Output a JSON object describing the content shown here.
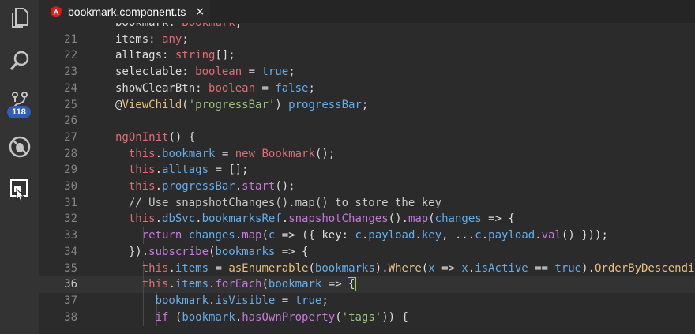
{
  "activity_bar": {
    "items": [
      {
        "name": "explorer-icon"
      },
      {
        "name": "search-icon"
      },
      {
        "name": "source-control-icon",
        "badge": "118"
      },
      {
        "name": "debug-icon"
      },
      {
        "name": "extensions-icon"
      }
    ]
  },
  "tab": {
    "title": "bookmark.component.ts",
    "close": "×",
    "icon": "angular-icon"
  },
  "editor": {
    "current_line": "36",
    "lines": [
      {
        "n": "",
        "indent": 1,
        "tokens": [
          [
            "p",
            "bookmark: "
          ],
          [
            "ty",
            "Bookmark"
          ],
          [
            "p",
            ";"
          ]
        ]
      },
      {
        "n": "21",
        "indent": 1,
        "tokens": [
          [
            "p",
            "items: "
          ],
          [
            "ty",
            "any"
          ],
          [
            "p",
            ";"
          ]
        ]
      },
      {
        "n": "22",
        "indent": 1,
        "tokens": [
          [
            "p",
            "alltags: "
          ],
          [
            "ty",
            "string"
          ],
          [
            "p",
            "[];"
          ]
        ]
      },
      {
        "n": "23",
        "indent": 1,
        "tokens": [
          [
            "p",
            "selectable: "
          ],
          [
            "ty",
            "boolean"
          ],
          [
            "p",
            " = "
          ],
          [
            "num",
            "true"
          ],
          [
            "p",
            ";"
          ]
        ]
      },
      {
        "n": "24",
        "indent": 1,
        "tokens": [
          [
            "p",
            "showClearBtn: "
          ],
          [
            "ty",
            "boolean"
          ],
          [
            "p",
            " = "
          ],
          [
            "num",
            "false"
          ],
          [
            "p",
            ";"
          ]
        ]
      },
      {
        "n": "25",
        "indent": 1,
        "tokens": [
          [
            "p",
            "@"
          ],
          [
            "dec",
            "ViewChild"
          ],
          [
            "p",
            "("
          ],
          [
            "s",
            "'progressBar'"
          ],
          [
            "p",
            ") "
          ],
          [
            "pr",
            "progressBar"
          ],
          [
            "p",
            ";"
          ]
        ]
      },
      {
        "n": "26",
        "indent": 1,
        "tokens": []
      },
      {
        "n": "27",
        "indent": 1,
        "tokens": [
          [
            "ty",
            "ngOnInit"
          ],
          [
            "p",
            "() {"
          ]
        ]
      },
      {
        "n": "28",
        "indent": 2,
        "tokens": [
          [
            "this",
            "this"
          ],
          [
            "p",
            "."
          ],
          [
            "pr",
            "bookmark"
          ],
          [
            "p",
            " = "
          ],
          [
            "k",
            "new "
          ],
          [
            "ty",
            "Bookmark"
          ],
          [
            "p",
            "();"
          ]
        ]
      },
      {
        "n": "29",
        "indent": 2,
        "tokens": [
          [
            "this",
            "this"
          ],
          [
            "p",
            "."
          ],
          [
            "pr",
            "alltags"
          ],
          [
            "p",
            " = [];"
          ]
        ]
      },
      {
        "n": "30",
        "indent": 2,
        "tokens": [
          [
            "this",
            "this"
          ],
          [
            "p",
            "."
          ],
          [
            "pr",
            "progressBar"
          ],
          [
            "p",
            "."
          ],
          [
            "fn",
            "start"
          ],
          [
            "p",
            "();"
          ]
        ]
      },
      {
        "n": "31",
        "indent": 2,
        "tokens": [
          [
            "c",
            "// Use snapshotChanges().map() to store the key"
          ]
        ]
      },
      {
        "n": "32",
        "indent": 2,
        "tokens": [
          [
            "this",
            "this"
          ],
          [
            "p",
            "."
          ],
          [
            "pr",
            "dbSvc"
          ],
          [
            "p",
            "."
          ],
          [
            "pr",
            "bookmarksRef"
          ],
          [
            "p",
            "."
          ],
          [
            "fn",
            "snapshotChanges"
          ],
          [
            "p",
            "()."
          ],
          [
            "fn",
            "map"
          ],
          [
            "p",
            "("
          ],
          [
            "pr",
            "changes"
          ],
          [
            "p",
            " => {"
          ]
        ]
      },
      {
        "n": "33",
        "indent": 3,
        "tokens": [
          [
            "kw",
            "return "
          ],
          [
            "pr",
            "changes"
          ],
          [
            "p",
            "."
          ],
          [
            "fn",
            "map"
          ],
          [
            "p",
            "("
          ],
          [
            "pr",
            "c"
          ],
          [
            "p",
            " => ({ key: "
          ],
          [
            "pr",
            "c"
          ],
          [
            "p",
            "."
          ],
          [
            "pr",
            "payload"
          ],
          [
            "p",
            "."
          ],
          [
            "pr",
            "key"
          ],
          [
            "p",
            ", ..."
          ],
          [
            "pr",
            "c"
          ],
          [
            "p",
            "."
          ],
          [
            "pr",
            "payload"
          ],
          [
            "p",
            "."
          ],
          [
            "fn",
            "val"
          ],
          [
            "p",
            "() }));"
          ]
        ]
      },
      {
        "n": "34",
        "indent": 2,
        "tokens": [
          [
            "p",
            "})."
          ],
          [
            "fn",
            "subscribe"
          ],
          [
            "p",
            "("
          ],
          [
            "pr",
            "bookmarks"
          ],
          [
            "p",
            " => {"
          ]
        ]
      },
      {
        "n": "35",
        "indent": 3,
        "tokens": [
          [
            "this",
            "this"
          ],
          [
            "p",
            "."
          ],
          [
            "pr",
            "items"
          ],
          [
            "p",
            " = "
          ],
          [
            "ob",
            "asEnumerable"
          ],
          [
            "p",
            "("
          ],
          [
            "pr",
            "bookmarks"
          ],
          [
            "p",
            ")."
          ],
          [
            "ob",
            "Where"
          ],
          [
            "p",
            "("
          ],
          [
            "pr",
            "x"
          ],
          [
            "p",
            " => "
          ],
          [
            "pr",
            "x"
          ],
          [
            "p",
            "."
          ],
          [
            "pr",
            "isActive"
          ],
          [
            "p",
            " == "
          ],
          [
            "num",
            "true"
          ],
          [
            "p",
            ")."
          ],
          [
            "ob",
            "OrderByDescending"
          ]
        ]
      },
      {
        "n": "36",
        "indent": 3,
        "tokens": [
          [
            "this",
            "this"
          ],
          [
            "p",
            "."
          ],
          [
            "pr",
            "items"
          ],
          [
            "p",
            "."
          ],
          [
            "fn",
            "forEach"
          ],
          [
            "p",
            "("
          ],
          [
            "pr",
            "bookmark"
          ],
          [
            "p",
            " => "
          ],
          [
            "br",
            "{"
          ]
        ]
      },
      {
        "n": "37",
        "indent": 4,
        "tokens": [
          [
            "pr",
            "bookmark"
          ],
          [
            "p",
            "."
          ],
          [
            "pr",
            "isVisible"
          ],
          [
            "p",
            " = "
          ],
          [
            "num",
            "true"
          ],
          [
            "p",
            ";"
          ]
        ]
      },
      {
        "n": "38",
        "indent": 4,
        "tokens": [
          [
            "kw",
            "if "
          ],
          [
            "p",
            "("
          ],
          [
            "pr",
            "bookmark"
          ],
          [
            "p",
            "."
          ],
          [
            "fn",
            "hasOwnProperty"
          ],
          [
            "p",
            "("
          ],
          [
            "s",
            "'tags'"
          ],
          [
            "p",
            ")) {"
          ]
        ]
      }
    ]
  }
}
